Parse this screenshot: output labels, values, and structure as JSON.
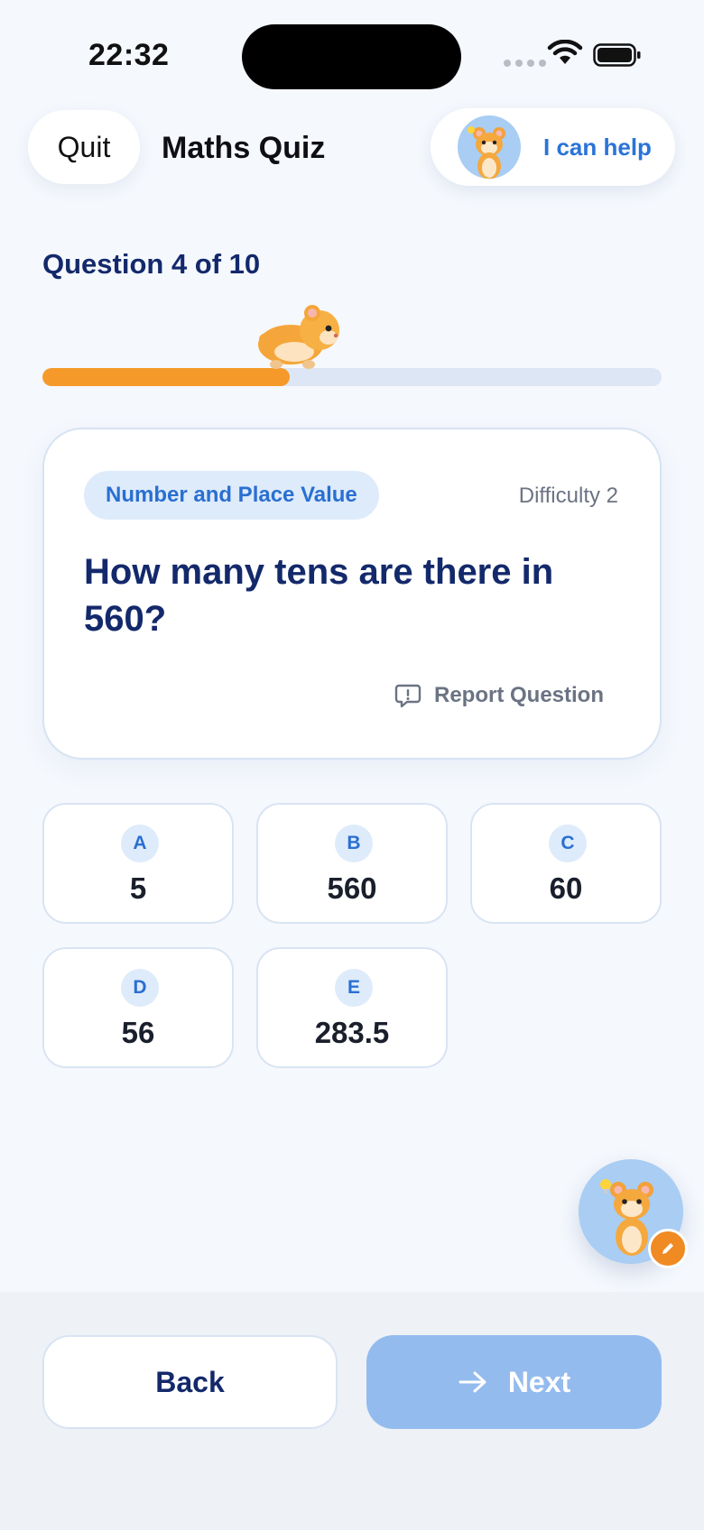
{
  "status_bar": {
    "time": "22:32"
  },
  "header": {
    "quit_label": "Quit",
    "title": "Maths Quiz",
    "help_label": "I can help"
  },
  "progress": {
    "label": "Question 4 of 10",
    "fraction": 0.4,
    "fill_color": "#f59a2a"
  },
  "question": {
    "topic": "Number and Place Value",
    "difficulty": "Difficulty 2",
    "text": "How many tens are there in 560?",
    "report_label": "Report Question"
  },
  "answers": [
    {
      "letter": "A",
      "value": "5"
    },
    {
      "letter": "B",
      "value": "560"
    },
    {
      "letter": "C",
      "value": "60"
    },
    {
      "letter": "D",
      "value": "56"
    },
    {
      "letter": "E",
      "value": "283.5"
    }
  ],
  "footer": {
    "back_label": "Back",
    "next_label": "Next",
    "next_enabled": false
  },
  "colors": {
    "accent": "#2a74d8",
    "navy": "#13296b",
    "orange": "#f59a2a",
    "next_disabled": "#94bbee"
  },
  "icons": {
    "help": "hamster-mascot-icon",
    "runner": "running-hamster-icon",
    "report": "report-bubble-icon",
    "next": "arrow-right-icon",
    "fab": "hamster-mascot-icon",
    "fab_badge": "pencil-icon"
  }
}
